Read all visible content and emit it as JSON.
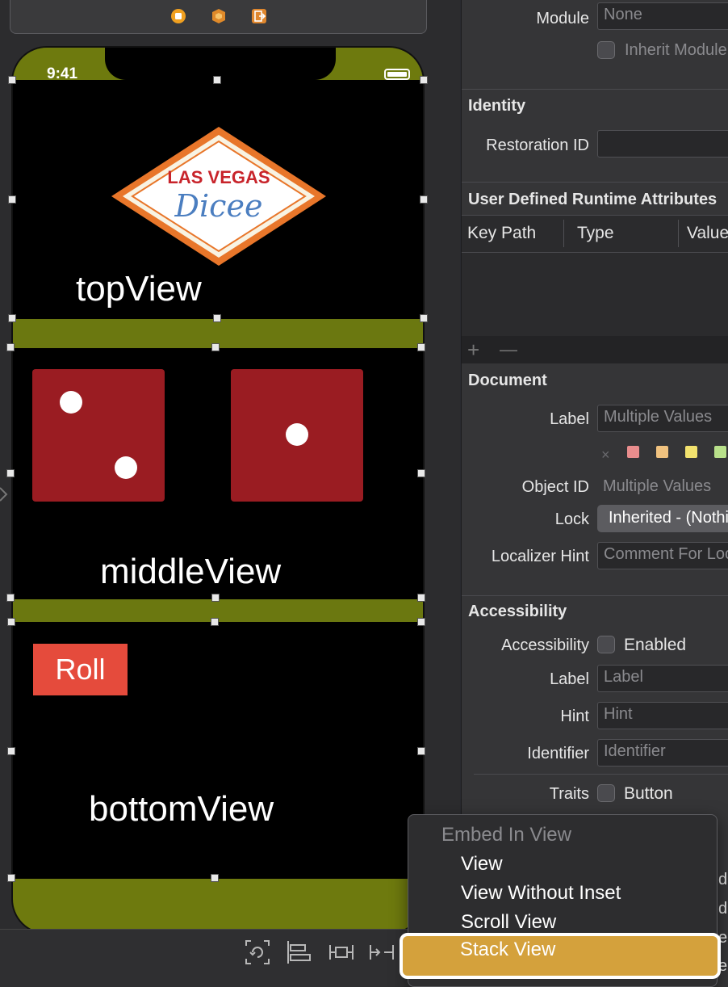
{
  "canvas": {
    "status_time": "9:41",
    "top_view_label": "topView",
    "middle_view_label": "middleView",
    "bottom_view_label": "bottomView",
    "logo": {
      "line1": "LAS VEGAS",
      "line2": "Dicee"
    },
    "roll_button_label": "Roll",
    "dice": [
      {
        "value": 2
      },
      {
        "value": 1
      }
    ]
  },
  "inspector": {
    "module": {
      "label": "Module",
      "value": "None",
      "inherit_label": "Inherit Module From Target"
    },
    "identity": {
      "header": "Identity",
      "restoration_id_label": "Restoration ID",
      "restoration_id_value": ""
    },
    "udra": {
      "header": "User Defined Runtime Attributes",
      "columns": [
        "Key Path",
        "Type",
        "Value"
      ],
      "add_label": "+",
      "remove_label": "—"
    },
    "document": {
      "header": "Document",
      "label_label": "Label",
      "label_placeholder": "Multiple Values",
      "object_id_label": "Object ID",
      "object_id_value": "Multiple Values",
      "lock_label": "Lock",
      "lock_value": "Inherited - (Nothing)",
      "localizer_hint_label": "Localizer Hint",
      "localizer_hint_placeholder": "Comment For Localizer",
      "swatch_colors": [
        "#e98d8d",
        "#f0c27f",
        "#f2e26e",
        "#b8e08a"
      ]
    },
    "accessibility": {
      "header": "Accessibility",
      "accessibility_label": "Accessibility",
      "enabled_label": "Enabled",
      "label_label": "Label",
      "label_placeholder": "Label",
      "hint_label": "Hint",
      "hint_placeholder": "Hint",
      "identifier_label": "Identifier",
      "identifier_placeholder": "Identifier",
      "traits_label": "Traits",
      "button_trait": "Button",
      "truncated": [
        "d",
        "d",
        "e",
        "e"
      ]
    }
  },
  "menu": {
    "header": "Embed In View",
    "items": [
      "View",
      "View Without Inset",
      "Scroll View",
      "Stack View"
    ]
  },
  "colors": {
    "accent_highlight": "#d4a13c",
    "die_red": "#9a1c22",
    "roll_button": "#e54b3c",
    "felt_green": "#6e7a0e"
  }
}
